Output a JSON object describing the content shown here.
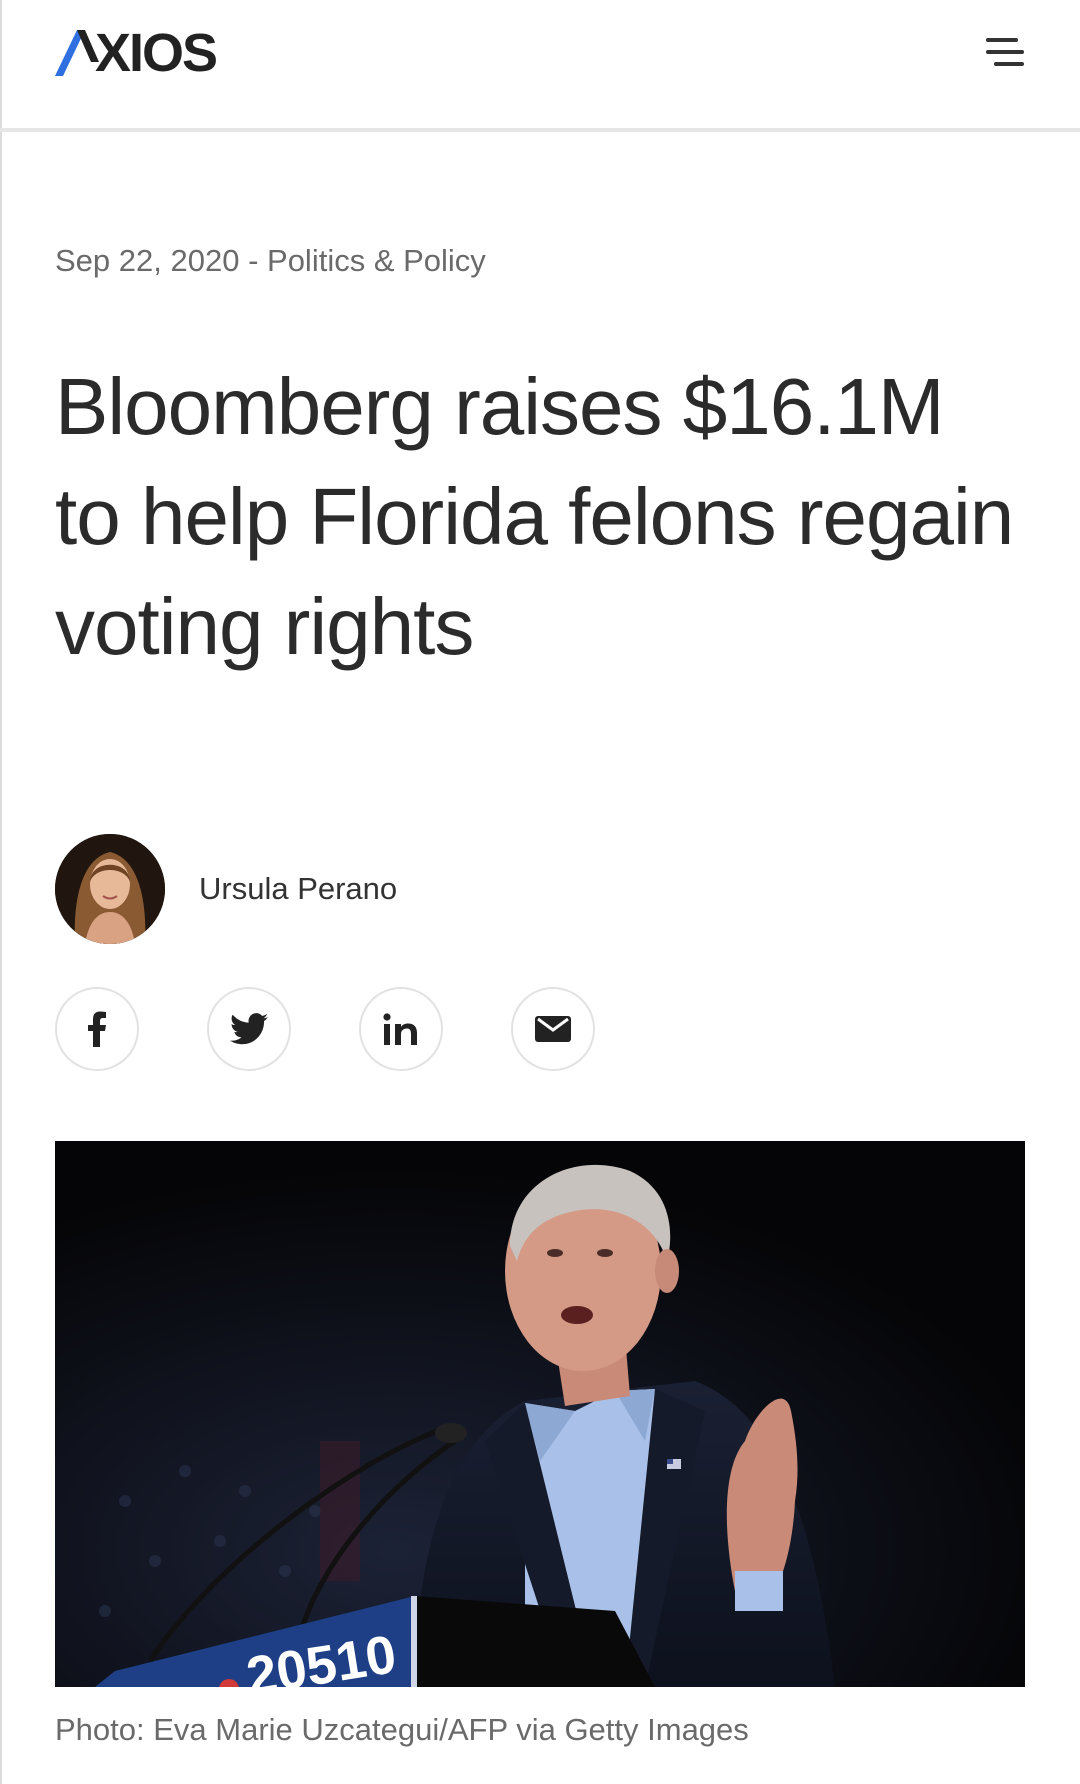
{
  "header": {
    "logo_text": "XIOS",
    "logo_alt": "AXIOS",
    "menu_icon": "hamburger-menu-icon"
  },
  "article": {
    "date": "Sep 22, 2020",
    "separator": " - ",
    "category": "Politics & Policy",
    "headline": "Bloomberg raises $16.1M to help Florida felons regain voting rights",
    "author": "Ursula Perano",
    "share": [
      {
        "name": "facebook",
        "icon": "facebook-icon"
      },
      {
        "name": "twitter",
        "icon": "twitter-icon"
      },
      {
        "name": "linkedin",
        "icon": "linkedin-icon"
      },
      {
        "name": "email",
        "icon": "email-icon"
      }
    ],
    "photo_podium_text": "20510",
    "photo_caption": "Photo: Eva Marie Uzcategui/AFP via Getty Images"
  },
  "colors": {
    "brand_blue": "#2f6fe0",
    "text_dark": "#2b2b2b",
    "text_muted": "#6a6a6a"
  }
}
